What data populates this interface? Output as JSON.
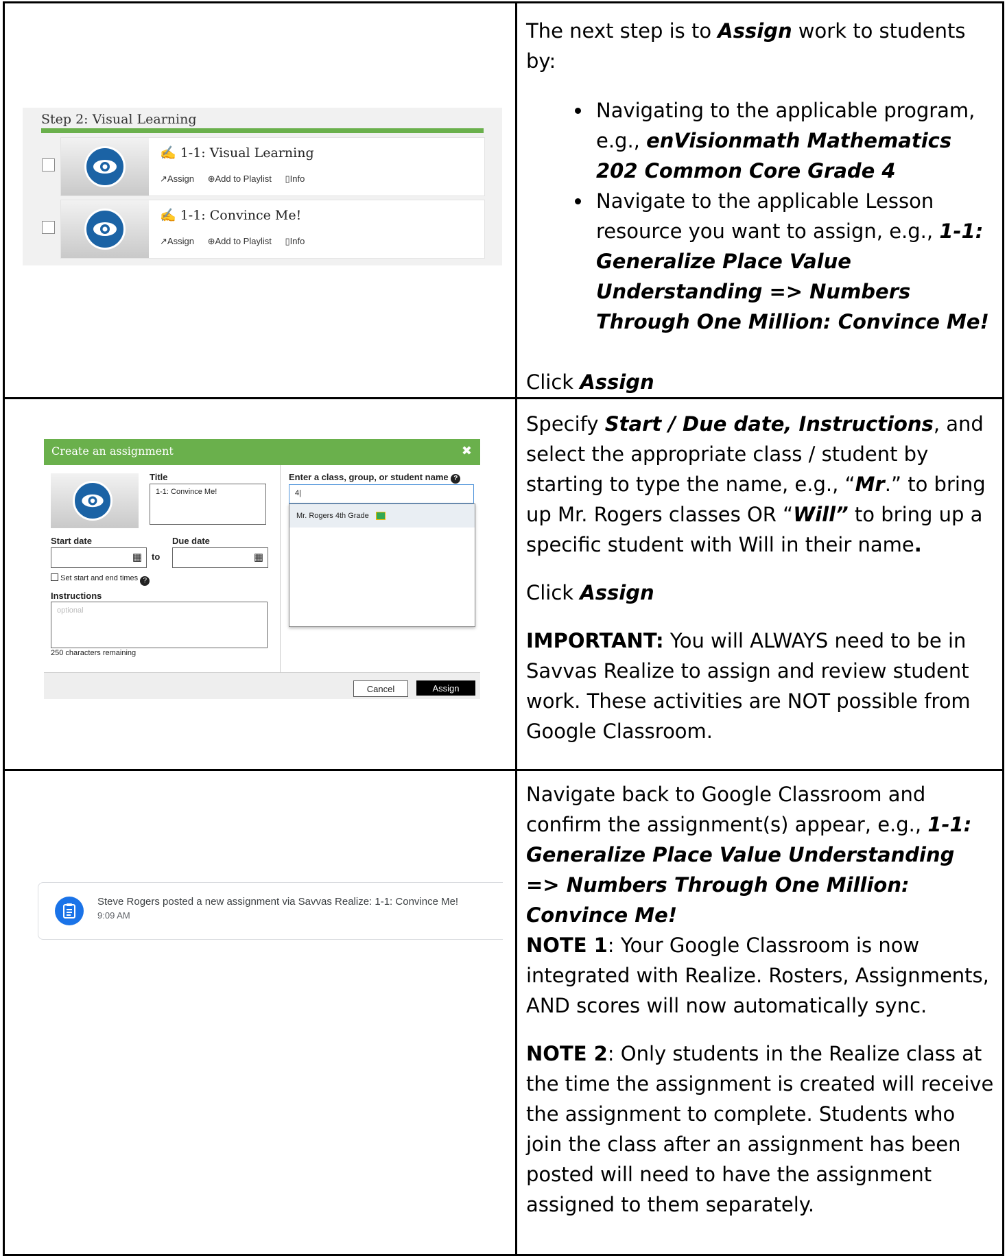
{
  "row1": {
    "screenshot": {
      "step_title": "Step 2: Visual Learning",
      "resources": [
        {
          "title": "1-1: Visual Learning",
          "actions": [
            "Assign",
            "Add to Playlist",
            "Info"
          ]
        },
        {
          "title": "1-1: Convince Me!",
          "actions": [
            "Assign",
            "Add to Playlist",
            "Info"
          ]
        }
      ]
    },
    "text": {
      "intro_pre": "The next step is to ",
      "intro_bold": "Assign",
      "intro_post": " work to students by:",
      "bullet1_pre": "Navigating to the applicable program, e.g., ",
      "bullet1_bold": "enVisionmath Mathematics 202 Common Core Grade 4",
      "bullet2_pre": "Navigate to the applicable Lesson resource you want to assign, e.g., ",
      "bullet2_bold": "1-1: Generalize Place Value Understanding => Numbers Through One Million: Convince Me!",
      "click_pre": "Click ",
      "click_bold": "Assign"
    }
  },
  "row2": {
    "dialog": {
      "title": "Create an assignment",
      "close": "✖",
      "title_label": "Title",
      "title_value": "1-1: Convince Me!",
      "start_label": "Start date",
      "due_label": "Due date",
      "to": "to",
      "set_times": "Set start and end times",
      "instructions_label": "Instructions",
      "instructions_placeholder": "optional",
      "remaining": "250 characters remaining",
      "search_label": "Enter a class, group, or student name",
      "search_value": "4",
      "suggestion": "Mr. Rogers 4th Grade",
      "cancel": "Cancel",
      "assign": "Assign"
    },
    "text": {
      "p1_a": "Specify ",
      "p1_b": "Start / Due date, Instructions",
      "p1_c": ", and select the appropriate class / student by starting to type the name, e.g., “",
      "p1_d": "Mr",
      "p1_e": ".” to bring up Mr. Rogers classes OR “",
      "p1_f": "Will”",
      "p1_g": " to bring up a specific student with Will in their name",
      "p1_h": ".",
      "click_pre": "Click ",
      "click_bold": "Assign",
      "imp_bold": "IMPORTANT:",
      "imp_text": "  You will ALWAYS need to be in Savvas Realize to assign and review student work.  These activities are NOT possible from Google Classroom."
    }
  },
  "row3": {
    "classroom": {
      "post": "Steve Rogers posted a new assignment via Savvas Realize: 1-1: Convince Me!",
      "time": "9:09 AM"
    },
    "text": {
      "p1_pre": "Navigate back to Google Classroom and confirm the assignment(s) appear, e.g., ",
      "p1_bold": "1-1: Generalize Place Value Understanding => Numbers Through One Million: Convince Me!",
      "note1_bold": "NOTE 1",
      "note1_text": ":  Your Google Classroom is now integrated with Realize. Rosters, Assignments, AND scores will now automatically sync.",
      "note2_bold": "NOTE 2",
      "note2_text": ":  Only students in the Realize class at the time the assignment is created will receive the assignment to complete. Students who join the class after an assignment has been posted will need to have the assignment assigned to them separately."
    }
  },
  "colors": {
    "green": "#6ab04c",
    "realize_blue": "#1b63a5",
    "classroom_blue": "#1a73e8"
  }
}
